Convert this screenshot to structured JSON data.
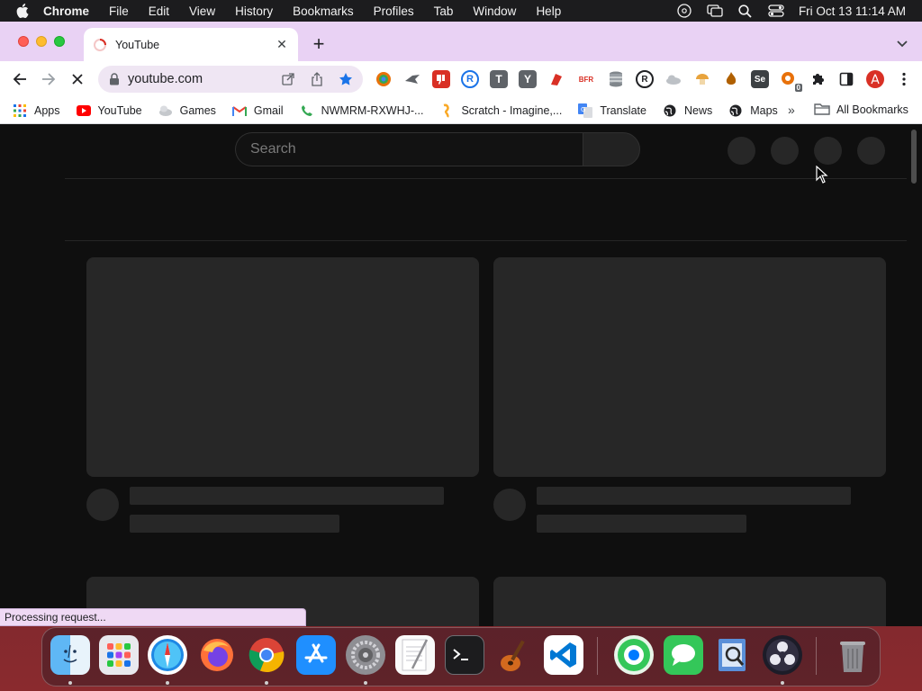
{
  "menubar": {
    "app_name": "Chrome",
    "items": [
      "File",
      "Edit",
      "View",
      "History",
      "Bookmarks",
      "Profiles",
      "Tab",
      "Window",
      "Help"
    ],
    "clock": "Fri Oct 13  11:14 AM"
  },
  "tab": {
    "title": "YouTube",
    "close_glyph": "✕",
    "newtab_glyph": "+"
  },
  "toolbar": {
    "url": "youtube.com",
    "extensions": [
      {
        "name": "color-picker-icon",
        "color": "#e8710a"
      },
      {
        "name": "bird-extension-icon",
        "color": "#5f6368"
      },
      {
        "name": "dislike-extension-icon",
        "color": "#d93025"
      },
      {
        "name": "r-extension-icon",
        "color": "#1a73e8",
        "text": "R"
      },
      {
        "name": "t-extension-icon",
        "color": "#5f6368",
        "text": "T"
      },
      {
        "name": "y-extension-icon",
        "color": "#5f6368",
        "text": "Y"
      },
      {
        "name": "red-extension-icon",
        "color": "#d93025"
      },
      {
        "name": "bfr-extension-icon",
        "color": "#d93025",
        "text": "BFR"
      },
      {
        "name": "database-extension-icon",
        "color": "#80868b"
      },
      {
        "name": "r-circle-extension-icon",
        "color": "#202124",
        "text": "R"
      },
      {
        "name": "cloud-extension-icon",
        "color": "#9aa0a6"
      },
      {
        "name": "mushroom-extension-icon",
        "color": "#e8a33c"
      },
      {
        "name": "flame-extension-icon",
        "color": "#b06000"
      },
      {
        "name": "se-extension-icon",
        "color": "#3c4043",
        "text": "Se"
      },
      {
        "name": "badge-extension-icon",
        "color": "#e8710a",
        "badge": "0"
      }
    ]
  },
  "bookmarks": {
    "items": [
      {
        "label": "Apps",
        "icon": "apps-grid-icon"
      },
      {
        "label": "YouTube",
        "icon": "youtube-icon"
      },
      {
        "label": "Games",
        "icon": "games-icon"
      },
      {
        "label": "Gmail",
        "icon": "gmail-icon"
      },
      {
        "label": "NWMRM-RXWHJ-...",
        "icon": "phone-icon"
      },
      {
        "label": "Scratch - Imagine,...",
        "icon": "scratch-icon"
      },
      {
        "label": "Translate",
        "icon": "translate-icon"
      },
      {
        "label": "News",
        "icon": "globe-icon"
      },
      {
        "label": "Maps",
        "icon": "globe-icon"
      }
    ],
    "more_glyph": "»",
    "all_label": "All Bookmarks"
  },
  "youtube": {
    "search_placeholder": "Search"
  },
  "status_text": "Processing request...",
  "dock": {
    "apps": [
      {
        "name": "finder-icon",
        "running": true
      },
      {
        "name": "launchpad-icon",
        "running": false
      },
      {
        "name": "safari-icon",
        "running": true
      },
      {
        "name": "firefox-icon",
        "running": false
      },
      {
        "name": "chrome-icon",
        "running": true
      },
      {
        "name": "app-store-icon",
        "running": false
      },
      {
        "name": "system-settings-icon",
        "running": true
      },
      {
        "name": "textedit-icon",
        "running": false
      },
      {
        "name": "terminal-icon",
        "running": false
      },
      {
        "name": "garageband-icon",
        "running": false
      },
      {
        "name": "vscode-icon",
        "running": false
      },
      {
        "name": "find-my-icon",
        "running": false
      },
      {
        "name": "messages-icon",
        "running": false
      },
      {
        "name": "preview-icon",
        "running": false
      },
      {
        "name": "obs-icon",
        "running": true
      },
      {
        "name": "trash-icon",
        "running": false
      }
    ]
  }
}
